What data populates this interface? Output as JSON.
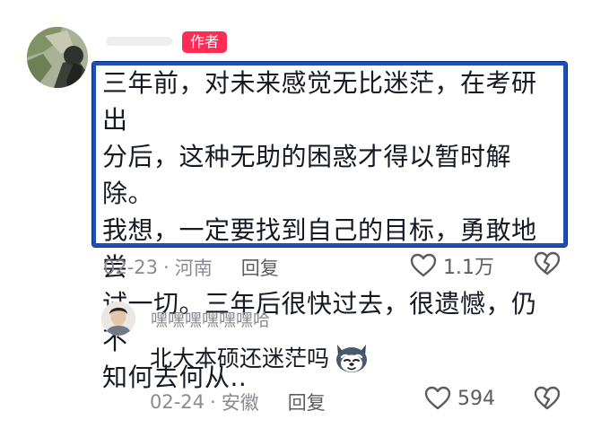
{
  "comment": {
    "author_badge": "作者",
    "text": "三年前，对未来感觉无比迷茫，在考研出\n分后，这种无助的困惑才得以暂时解除。\n我想，一定要找到自己的目标，勇敢地尝\n试一切。三年后很快过去，很遗憾，仍不\n知何去何从..",
    "date": "02-23",
    "location": "河南",
    "reply_label": "回复",
    "like_count": "1.1万"
  },
  "reply": {
    "username": "嘿嘿嘿嘿嘿嘿哈",
    "text": "北大本硕还迷茫吗",
    "date": "02-24",
    "location": "安徽",
    "reply_label": "回复",
    "like_count": "594"
  },
  "meta_separator": "·",
  "icons": {
    "like": "heart-outline-icon",
    "dislike": "broken-heart-icon",
    "reply_emoji": "husky-dog-emoji-icon"
  },
  "colors": {
    "highlight_border": "#1d4fb4",
    "author_badge": "#fe2c55",
    "meta_text": "#8a8b91",
    "icon": "#5c5d63"
  }
}
